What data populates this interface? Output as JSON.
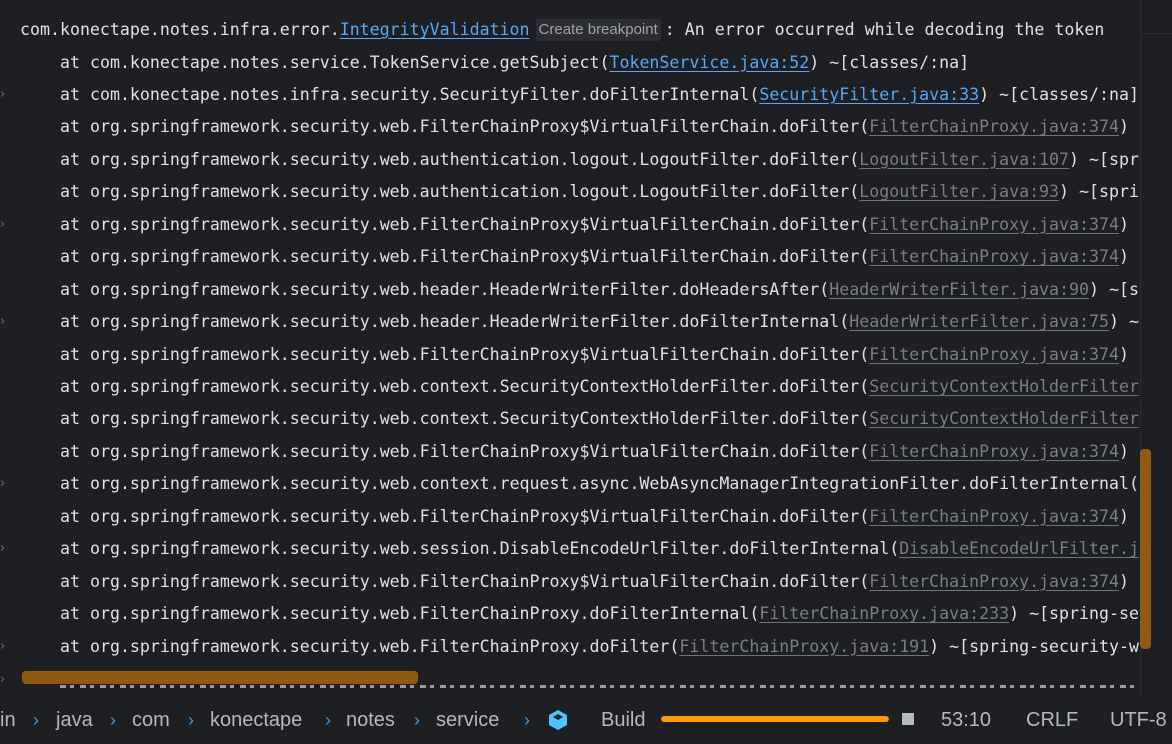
{
  "console": {
    "header": {
      "prefix": "com.konectape.notes.infra.error.",
      "exception_link": "IntegrityValidation",
      "breakpoint_hint": "Create breakpoint",
      "message": ": An error occurred while decoding the token"
    },
    "frames": [
      {
        "pre": "at com.konectape.notes.service.TokenService.getSubject(",
        "link": "TokenService.java:52",
        "post": ") ~[classes/:na]",
        "link_style": "blue",
        "fold": false
      },
      {
        "pre": "at com.konectape.notes.infra.security.SecurityFilter.doFilterInternal(",
        "link": "SecurityFilter.java:33",
        "post": ") ~[classes/:na]",
        "link_style": "blue",
        "fold": true
      },
      {
        "pre": "at org.springframework.security.web.FilterChainProxy$VirtualFilterChain.doFilter(",
        "link": "FilterChainProxy.java:374",
        "post": ")",
        "link_style": "grey",
        "fold": false
      },
      {
        "pre": "at org.springframework.security.web.authentication.logout.LogoutFilter.doFilter(",
        "link": "LogoutFilter.java:107",
        "post": ") ~[spr",
        "link_style": "grey",
        "fold": false
      },
      {
        "pre": "at org.springframework.security.web.authentication.logout.LogoutFilter.doFilter(",
        "link": "LogoutFilter.java:93",
        "post": ") ~[spri",
        "link_style": "grey",
        "fold": false
      },
      {
        "pre": "at org.springframework.security.web.FilterChainProxy$VirtualFilterChain.doFilter(",
        "link": "FilterChainProxy.java:374",
        "post": ")",
        "link_style": "grey",
        "fold": true
      },
      {
        "pre": "at org.springframework.security.web.FilterChainProxy$VirtualFilterChain.doFilter(",
        "link": "FilterChainProxy.java:374",
        "post": ")",
        "link_style": "grey",
        "fold": false
      },
      {
        "pre": "at org.springframework.security.web.header.HeaderWriterFilter.doHeadersAfter(",
        "link": "HeaderWriterFilter.java:90",
        "post": ") ~[s",
        "link_style": "grey",
        "fold": false
      },
      {
        "pre": "at org.springframework.security.web.header.HeaderWriterFilter.doFilterInternal(",
        "link": "HeaderWriterFilter.java:75",
        "post": ") ~",
        "link_style": "grey",
        "fold": true
      },
      {
        "pre": "at org.springframework.security.web.FilterChainProxy$VirtualFilterChain.doFilter(",
        "link": "FilterChainProxy.java:374",
        "post": ")",
        "link_style": "grey",
        "fold": false
      },
      {
        "pre": "at org.springframework.security.web.context.SecurityContextHolderFilter.doFilter(",
        "link": "SecurityContextHolderFilter",
        "post": "",
        "link_style": "grey",
        "fold": false
      },
      {
        "pre": "at org.springframework.security.web.context.SecurityContextHolderFilter.doFilter(",
        "link": "SecurityContextHolderFilter",
        "post": "",
        "link_style": "grey",
        "fold": false
      },
      {
        "pre": "at org.springframework.security.web.FilterChainProxy$VirtualFilterChain.doFilter(",
        "link": "FilterChainProxy.java:374",
        "post": ")",
        "link_style": "grey",
        "fold": false
      },
      {
        "pre": "at org.springframework.security.web.context.request.async.WebAsyncManagerIntegrationFilter.doFilterInternal(",
        "link": "",
        "post": "",
        "link_style": "grey",
        "fold": true
      },
      {
        "pre": "at org.springframework.security.web.FilterChainProxy$VirtualFilterChain.doFilter(",
        "link": "FilterChainProxy.java:374",
        "post": ")",
        "link_style": "grey",
        "fold": false
      },
      {
        "pre": "at org.springframework.security.web.session.DisableEncodeUrlFilter.doFilterInternal(",
        "link": "DisableEncodeUrlFilter.j",
        "post": "",
        "link_style": "grey",
        "fold": true
      },
      {
        "pre": "at org.springframework.security.web.FilterChainProxy$VirtualFilterChain.doFilter(",
        "link": "FilterChainProxy.java:374",
        "post": ")",
        "link_style": "grey",
        "fold": false
      },
      {
        "pre": "at org.springframework.security.web.FilterChainProxy.doFilterInternal(",
        "link": "FilterChainProxy.java:233",
        "post": ") ~[spring-se",
        "link_style": "grey",
        "fold": false
      },
      {
        "pre": "at org.springframework.security.web.FilterChainProxy.doFilter(",
        "link": "FilterChainProxy.java:191",
        "post": ") ~[spring-security-w",
        "link_style": "grey",
        "fold": true
      }
    ],
    "partial_last_row_fold": true
  },
  "statusbar": {
    "breadcrumbs": [
      "in",
      "java",
      "com",
      "konectape",
      "notes",
      "service"
    ],
    "separator": "›",
    "file_icon": "java-class-cube-icon",
    "build_label": "Build",
    "build_progress": 1.0,
    "cursor_position": "53:10",
    "line_separator": "CRLF",
    "encoding": "UTF-8"
  },
  "colors": {
    "background": "#1e1f22",
    "text": "#dfe1e5",
    "link_blue": "#56a8f5",
    "link_grey": "#7a7e85",
    "scrollbar_thumb": "#8f5a12",
    "progress": "#ff9a00",
    "breadcrumb_separator": "#3d9be9",
    "icon_blue": "#4fc3f7"
  }
}
